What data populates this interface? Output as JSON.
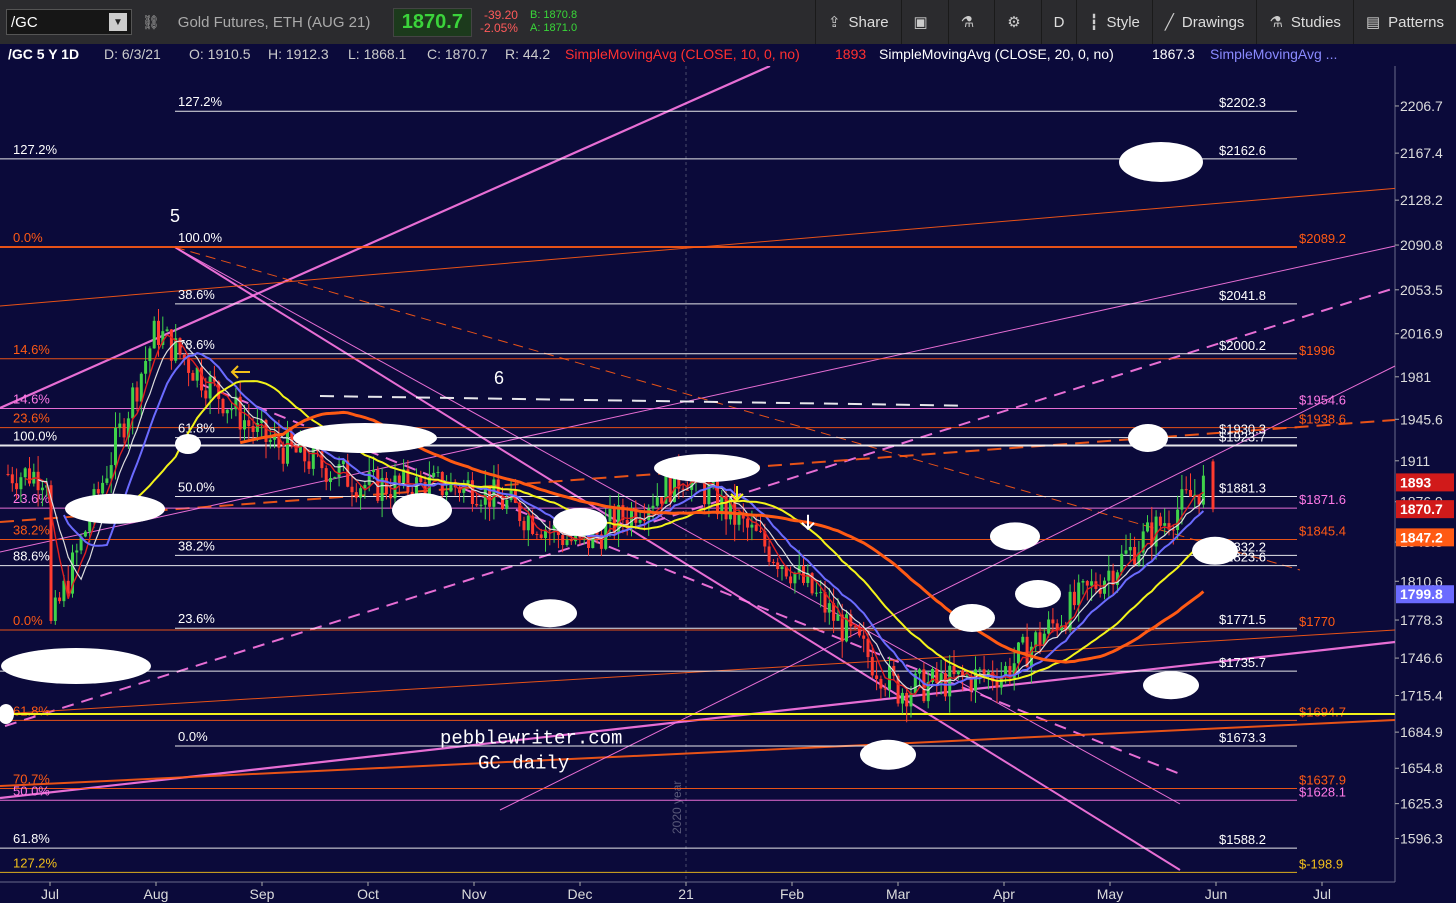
{
  "toolbar": {
    "symbol": "/GC",
    "description": "Gold Futures, ETH (AUG 21)",
    "last": "1870.7",
    "change": "-39.20",
    "change_pct": "-2.05%",
    "bid": "B: 1870.8",
    "ask": "A: 1871.0",
    "buttons": {
      "share": "Share",
      "aggregation": "D",
      "style": "Style",
      "drawings": "Drawings",
      "studies": "Studies",
      "patterns": "Patterns"
    }
  },
  "infobar": {
    "symbol": "/GC 5 Y 1D",
    "date": "D: 6/3/21",
    "open": "O: 1910.5",
    "high": "H: 1912.3",
    "low": "L: 1868.1",
    "close": "C: 1870.7",
    "range": "R: 44.2",
    "study1_name": "SimpleMovingAvg (CLOSE, 10, 0, no)",
    "study1_val": "1893",
    "study2_name": "SimpleMovingAvg (CLOSE, 20, 0, no)",
    "study2_val": "1867.3",
    "study3_name": "SimpleMovingAvg ..."
  },
  "colors": {
    "bg": "#0b0a3a",
    "up": "#3fd24a",
    "down": "#ff3b2f",
    "pink": "#ff79e6",
    "orange": "#ff5a14",
    "yellow": "#f3f31a",
    "blue": "#6b6bff",
    "white": "#ffffff"
  },
  "chart_data": {
    "type": "candlestick",
    "y_range": [
      1560,
      2240
    ],
    "y_ticks": [
      "2206.7",
      "2167.4",
      "2128.2",
      "2090.8",
      "2053.5",
      "2016.9",
      "1981",
      "1945.6",
      "1911",
      "1876.9",
      "1843.3",
      "1810.6",
      "1778.3",
      "1746.6",
      "1715.4",
      "1684.9",
      "1654.8",
      "1625.3",
      "1596.3"
    ],
    "x_ticks": [
      "Jul",
      "Aug",
      "Sep",
      "Oct",
      "Nov",
      "Dec",
      "21",
      "Feb",
      "Mar",
      "Apr",
      "May",
      "Jun",
      "Jul"
    ],
    "price_badges": [
      {
        "value": 1893,
        "label": "1893",
        "color": "#d11a1a"
      },
      {
        "value": 1870.7,
        "label": "1870.7",
        "color": "#d11a1a"
      },
      {
        "value": 1847.2,
        "label": "1847.2",
        "color": "#ff5a14"
      },
      {
        "value": 1799.8,
        "label": "1799.8",
        "color": "#6b6bff"
      }
    ],
    "levels": [
      {
        "value": 2202.3,
        "label": "$2202.3",
        "color": "#ffffff",
        "left_label": "127.2%",
        "left_x": "fib"
      },
      {
        "value": 2162.6,
        "label": "$2162.6",
        "color": "#ffffff",
        "left_label": "127.2%",
        "left_x": "edge"
      },
      {
        "value": 2089.2,
        "label": "$2089.2",
        "color": "#ff5a14",
        "left_label": "0.0%",
        "left_x": "edge",
        "thick": true
      },
      {
        "value": 2041.8,
        "label": "$2041.8",
        "color": "#ffffff",
        "left_label": "38.6%",
        "left_x": "fib"
      },
      {
        "value": 2000.2,
        "label": "$2000.2",
        "color": "#ffffff",
        "left_label": "78.6%",
        "left_x": "fib"
      },
      {
        "value": 1996,
        "label": "$1996",
        "color": "#ff5a14",
        "left_label": "14.6%",
        "left_x": "edge"
      },
      {
        "value": 1954.6,
        "label": "$1954.6",
        "color": "#ff79e6",
        "left_label": "14.6%",
        "left_x": "edge"
      },
      {
        "value": 1938.6,
        "label": "$1938.6",
        "color": "#ff5a14",
        "left_label": "23.6%",
        "left_x": "edge"
      },
      {
        "value": 1930.3,
        "label": "$1930.3",
        "color": "#ffffff",
        "left_label": "61.8%",
        "left_x": "fib"
      },
      {
        "value": 1923.7,
        "label": "$1923.7",
        "color": "#ffffff",
        "left_label": "100.0%",
        "left_x": "edge",
        "thick": true
      },
      {
        "value": 1881.3,
        "label": "$1881.3",
        "color": "#ffffff",
        "left_label": "50.0%",
        "left_x": "fib"
      },
      {
        "value": 1871.6,
        "label": "$1871.6",
        "color": "#ff79e6",
        "left_label": "23.6%",
        "left_x": "edge"
      },
      {
        "value": 1845.4,
        "label": "$1845.4",
        "color": "#ff5a14",
        "left_label": "38.2%",
        "left_x": "edge"
      },
      {
        "value": 1832.2,
        "label": "$1832.2",
        "color": "#ffffff",
        "left_label": "38.2%",
        "left_x": "fib"
      },
      {
        "value": 1823.6,
        "label": "$1823.6",
        "color": "#ffffff",
        "left_label": "88.6%",
        "left_x": "edge"
      },
      {
        "value": 1771.5,
        "label": "$1771.5",
        "color": "#ffffff",
        "left_label": "23.6%",
        "left_x": "fib"
      },
      {
        "value": 1770,
        "label": "$1770",
        "color": "#ff5a14",
        "left_label": "0.0%",
        "left_x": "edge"
      },
      {
        "value": 1735.7,
        "label": "$1735.7",
        "color": "#ffffff",
        "left_label": "78.6%",
        "left_x": "edge"
      },
      {
        "value": 1694.7,
        "label": "$1694.7",
        "color": "#ff5a14",
        "left_label": "61.8%",
        "left_x": "edge"
      },
      {
        "value": 1673.3,
        "label": "$1673.3",
        "color": "#ffffff",
        "left_label": "0.0%",
        "left_x": "fib"
      },
      {
        "value": 1637.9,
        "label": "$1637.9",
        "color": "#ff5a14",
        "left_label": "70.7%",
        "left_x": "edge"
      },
      {
        "value": 1628.1,
        "label": "$1628.1",
        "color": "#ff79e6",
        "left_label": "50.0%",
        "left_x": "edge"
      },
      {
        "value": 1588.2,
        "label": "$1588.2",
        "color": "#ffffff",
        "left_label": "61.8%",
        "left_x": "edge"
      },
      {
        "value": 1568,
        "label": "$-198.9",
        "color": "#f3c01a",
        "left_label": "127.2%",
        "left_x": "edge"
      }
    ],
    "sma_yellow_level": 1700,
    "annotations": {
      "wave5": "5",
      "wave6": "6",
      "fib_top": "100.0%",
      "watermark": "pebblewriter.com",
      "caption": "GC daily",
      "year_marker": "2020 year"
    },
    "anchors": [
      {
        "month": "Jul",
        "price": 1770
      },
      {
        "month": "Aug",
        "price": 2020
      },
      {
        "month": "Sep",
        "price": 1930
      },
      {
        "month": "Oct",
        "price": 1890
      },
      {
        "month": "Nov",
        "price": 1890
      },
      {
        "month": "Dec",
        "price": 1840
      },
      {
        "month": "21",
        "price": 1900
      },
      {
        "month": "Feb",
        "price": 1820
      },
      {
        "month": "Mar",
        "price": 1720
      },
      {
        "month": "Apr",
        "price": 1735
      },
      {
        "month": "May",
        "price": 1820
      },
      {
        "month": "Jun",
        "price": 1900
      }
    ],
    "last_bar": {
      "open": 1910.5,
      "high": 1912.3,
      "low": 1868.1,
      "close": 1870.7
    }
  }
}
